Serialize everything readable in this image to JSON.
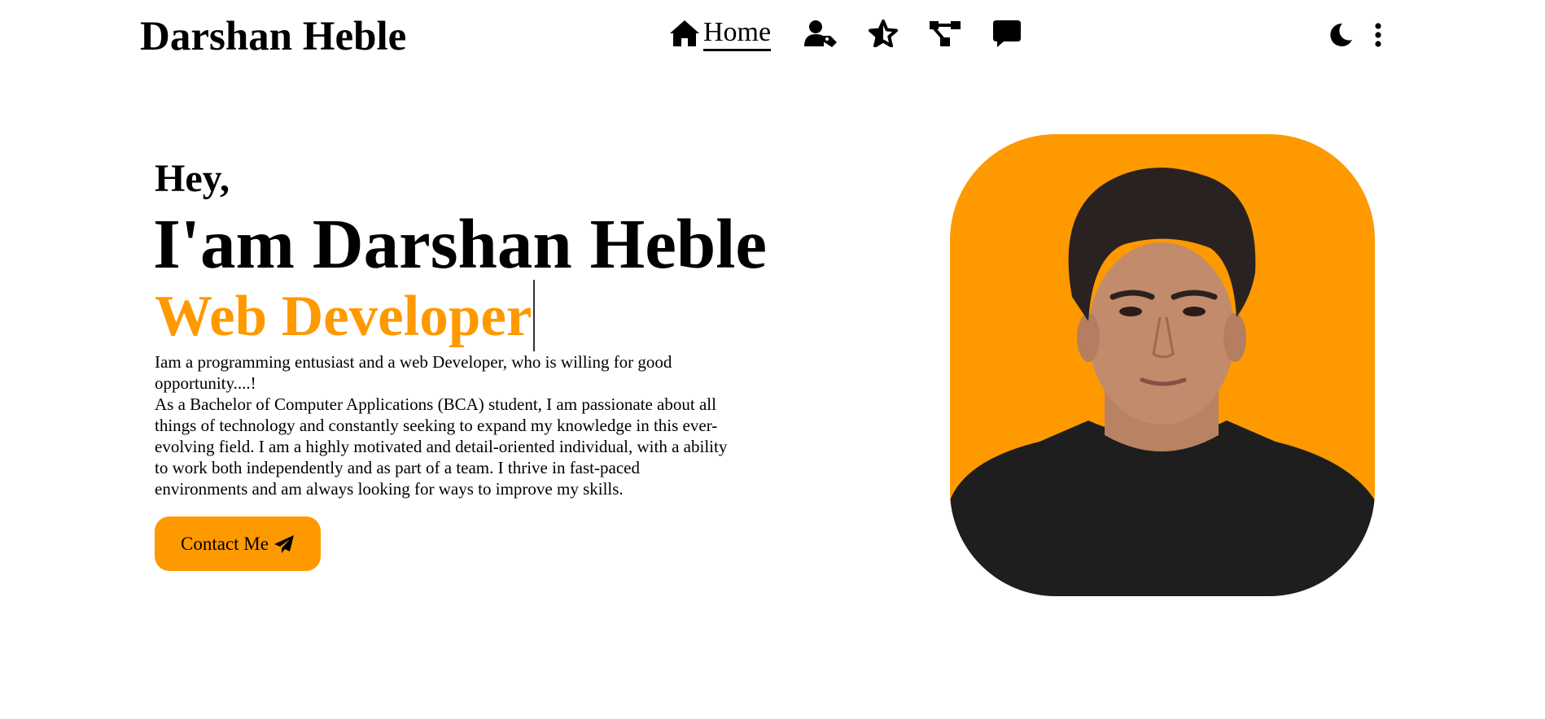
{
  "header": {
    "brand": "Darshan Heble",
    "nav": {
      "home_label": "Home",
      "home_icon": "house-icon",
      "about_icon": "user-tag-icon",
      "skills_icon": "star-icon",
      "projects_icon": "diagram-icon",
      "contact_icon": "message-icon"
    },
    "theme_icon": "moon-icon",
    "menu_icon": "vertical-ellipsis-icon"
  },
  "hero": {
    "greeting": "Hey,",
    "headline": "I'am Darshan Heble",
    "role": "Web Developer",
    "bio_lines": [
      "Iam a programming entusiast and a web Developer, who is willing for good",
      "opportunity....!",
      "As a Bachelor of Computer Applications (BCA) student, I am passionate about all",
      "things of technology and constantly seeking to expand my knowledge in this ever-",
      "evolving field. I am a highly motivated and detail-oriented individual, with a ability",
      "to work both independently and as part of a team. I thrive in fast-paced",
      "environments and am always looking for ways to improve my skills."
    ],
    "contact_button": "Contact Me",
    "contact_icon": "paper-plane-icon"
  },
  "colors": {
    "accent": "#ff9900",
    "text": "#000000",
    "background": "#ffffff"
  }
}
